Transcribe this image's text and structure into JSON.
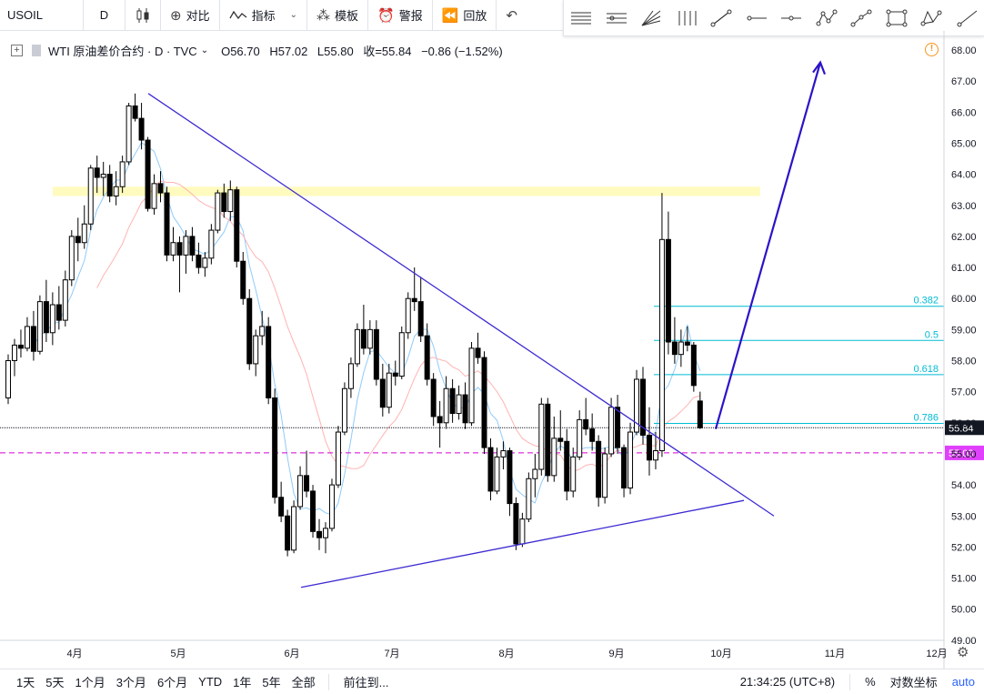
{
  "toolbar": {
    "symbol": "USOIL",
    "resolution": "D",
    "compare": "对比",
    "indicators": "指标",
    "templates": "模板",
    "alert": "警报",
    "replay": "回放"
  },
  "legend": {
    "title": "WTI 原油差价合约 · D · TVC",
    "open": "O56.70",
    "high": "H57.02",
    "low": "L55.80",
    "close": "收=55.84",
    "change": "−0.86 (−1.52%)"
  },
  "drawing_tools": [
    "horizontal-lines-icon",
    "channel-icon",
    "fan-icon",
    "pitchfork-icon",
    "trend-line-icon",
    "horizontal-ray-icon",
    "horizontal-line-icon",
    "pattern-icon",
    "polyline-icon",
    "rectangle-icon",
    "xabcd-icon",
    "ray-icon"
  ],
  "price_axis": {
    "labels": [
      "68.00",
      "67.00",
      "66.00",
      "65.00",
      "64.00",
      "63.00",
      "62.00",
      "61.00",
      "60.00",
      "59.00",
      "58.00",
      "57.00",
      "56.00",
      "55.00",
      "54.00",
      "53.00",
      "52.00",
      "51.00",
      "50.00",
      "49.00"
    ],
    "last_price": "55.84",
    "dashed_level": "55.03"
  },
  "time_axis": {
    "labels": [
      "4月",
      "5月",
      "6月",
      "7月",
      "8月",
      "9月",
      "10月",
      "11月",
      "12月"
    ]
  },
  "fib_labels": [
    "0.382",
    "0.5",
    "0.618",
    "0.786"
  ],
  "bottom": {
    "ranges": [
      "1天",
      "5天",
      "1个月",
      "3个月",
      "6个月",
      "YTD",
      "1年",
      "5年",
      "全部"
    ],
    "goto": "前往到...",
    "clock": "21:34:25 (UTC+8)",
    "percent": "%",
    "log": "对数坐标",
    "auto": "auto"
  },
  "colors": {
    "trendline": "#3d2bd1",
    "arrow": "#2b13c8",
    "resistance_zone": "#fffbbf",
    "fib": "#00bcd4",
    "dashed_level": "#d500d5",
    "last_price_bg": "#131722",
    "dashed_level_bg": "#e040fb",
    "ma_fast": "#90caf9",
    "ma_slow": "#ffb3b3"
  },
  "chart_data": {
    "type": "candlestick",
    "title": "",
    "ylim": [
      49,
      68
    ],
    "y_ticks": [
      68,
      67,
      66,
      65,
      64,
      63,
      62,
      61,
      60,
      59,
      58,
      57,
      56,
      55,
      54,
      53,
      52,
      51,
      50,
      49
    ],
    "x_ticks": [
      "4月",
      "5月",
      "6月",
      "7月",
      "8月",
      "9月",
      "10月",
      "11月",
      "12月"
    ],
    "last_price": 55.84,
    "dashed_level": 55.03,
    "resistance_zone": [
      63.3,
      63.6
    ],
    "fib_levels": [
      {
        "label": "0.382",
        "value": 59.75
      },
      {
        "label": "0.5",
        "value": 58.65
      },
      {
        "label": "0.618",
        "value": 57.55
      },
      {
        "label": "0.786",
        "value": 55.98
      }
    ],
    "candles": [
      {
        "o": 56.8,
        "h": 58.2,
        "l": 56.6,
        "c": 58.0
      },
      {
        "o": 58.0,
        "h": 58.7,
        "l": 57.5,
        "c": 58.5
      },
      {
        "o": 58.5,
        "h": 59.0,
        "l": 58.1,
        "c": 58.4
      },
      {
        "o": 58.4,
        "h": 59.4,
        "l": 58.3,
        "c": 59.1
      },
      {
        "o": 59.1,
        "h": 59.6,
        "l": 58.0,
        "c": 58.3
      },
      {
        "o": 58.3,
        "h": 60.1,
        "l": 58.2,
        "c": 59.9
      },
      {
        "o": 59.9,
        "h": 60.6,
        "l": 58.6,
        "c": 58.9
      },
      {
        "o": 58.9,
        "h": 60.2,
        "l": 58.5,
        "c": 59.8
      },
      {
        "o": 59.8,
        "h": 60.4,
        "l": 59.0,
        "c": 59.3
      },
      {
        "o": 59.3,
        "h": 60.9,
        "l": 59.1,
        "c": 60.6
      },
      {
        "o": 60.6,
        "h": 62.2,
        "l": 60.4,
        "c": 62.0
      },
      {
        "o": 62.0,
        "h": 62.6,
        "l": 61.2,
        "c": 61.8
      },
      {
        "o": 61.8,
        "h": 63.0,
        "l": 61.6,
        "c": 62.4
      },
      {
        "o": 62.4,
        "h": 64.3,
        "l": 62.2,
        "c": 64.2
      },
      {
        "o": 64.2,
        "h": 64.6,
        "l": 63.4,
        "c": 63.9
      },
      {
        "o": 63.9,
        "h": 64.4,
        "l": 63.3,
        "c": 64.0
      },
      {
        "o": 64.0,
        "h": 64.3,
        "l": 63.1,
        "c": 63.3
      },
      {
        "o": 63.3,
        "h": 64.1,
        "l": 63.0,
        "c": 63.6
      },
      {
        "o": 63.6,
        "h": 64.6,
        "l": 63.4,
        "c": 64.4
      },
      {
        "o": 64.4,
        "h": 66.3,
        "l": 64.3,
        "c": 66.2
      },
      {
        "o": 66.2,
        "h": 66.6,
        "l": 65.7,
        "c": 65.8
      },
      {
        "o": 65.8,
        "h": 66.3,
        "l": 64.8,
        "c": 65.1
      },
      {
        "o": 65.1,
        "h": 65.2,
        "l": 62.8,
        "c": 62.9
      },
      {
        "o": 62.9,
        "h": 64.0,
        "l": 62.7,
        "c": 63.7
      },
      {
        "o": 63.7,
        "h": 64.1,
        "l": 63.1,
        "c": 63.4
      },
      {
        "o": 63.4,
        "h": 63.6,
        "l": 61.2,
        "c": 61.4
      },
      {
        "o": 61.4,
        "h": 62.3,
        "l": 61.2,
        "c": 61.8
      },
      {
        "o": 61.8,
        "h": 62.0,
        "l": 60.2,
        "c": 61.4
      },
      {
        "o": 61.4,
        "h": 62.2,
        "l": 60.8,
        "c": 62.0
      },
      {
        "o": 62.0,
        "h": 62.3,
        "l": 61.2,
        "c": 61.4
      },
      {
        "o": 61.4,
        "h": 61.8,
        "l": 60.8,
        "c": 61.0
      },
      {
        "o": 61.0,
        "h": 61.5,
        "l": 60.7,
        "c": 61.3
      },
      {
        "o": 61.3,
        "h": 62.4,
        "l": 61.1,
        "c": 62.2
      },
      {
        "o": 62.2,
        "h": 63.5,
        "l": 62.1,
        "c": 63.4
      },
      {
        "o": 63.4,
        "h": 63.7,
        "l": 62.6,
        "c": 62.8
      },
      {
        "o": 62.8,
        "h": 63.8,
        "l": 62.5,
        "c": 63.5
      },
      {
        "o": 63.5,
        "h": 63.6,
        "l": 61.0,
        "c": 61.2
      },
      {
        "o": 61.2,
        "h": 61.5,
        "l": 59.8,
        "c": 60.0
      },
      {
        "o": 60.0,
        "h": 60.3,
        "l": 57.7,
        "c": 57.9
      },
      {
        "o": 57.9,
        "h": 59.0,
        "l": 57.5,
        "c": 58.8
      },
      {
        "o": 58.8,
        "h": 59.6,
        "l": 58.5,
        "c": 59.1
      },
      {
        "o": 59.1,
        "h": 59.4,
        "l": 56.6,
        "c": 56.8
      },
      {
        "o": 56.8,
        "h": 57.1,
        "l": 53.4,
        "c": 53.6
      },
      {
        "o": 53.6,
        "h": 54.1,
        "l": 52.8,
        "c": 53.0
      },
      {
        "o": 53.0,
        "h": 53.2,
        "l": 51.7,
        "c": 51.9
      },
      {
        "o": 51.9,
        "h": 53.5,
        "l": 51.8,
        "c": 53.3
      },
      {
        "o": 53.3,
        "h": 54.6,
        "l": 53.2,
        "c": 54.3
      },
      {
        "o": 54.3,
        "h": 55.1,
        "l": 53.6,
        "c": 53.8
      },
      {
        "o": 53.8,
        "h": 54.0,
        "l": 52.3,
        "c": 52.5
      },
      {
        "o": 52.5,
        "h": 52.9,
        "l": 51.9,
        "c": 52.3
      },
      {
        "o": 52.3,
        "h": 52.8,
        "l": 51.8,
        "c": 52.6
      },
      {
        "o": 52.6,
        "h": 54.2,
        "l": 52.5,
        "c": 54.0
      },
      {
        "o": 54.0,
        "h": 55.9,
        "l": 53.9,
        "c": 55.7
      },
      {
        "o": 55.7,
        "h": 57.3,
        "l": 55.6,
        "c": 57.1
      },
      {
        "o": 57.1,
        "h": 58.1,
        "l": 56.8,
        "c": 57.9
      },
      {
        "o": 57.9,
        "h": 59.2,
        "l": 57.8,
        "c": 59.0
      },
      {
        "o": 59.0,
        "h": 59.8,
        "l": 58.2,
        "c": 58.4
      },
      {
        "o": 58.4,
        "h": 59.3,
        "l": 58.2,
        "c": 59.0
      },
      {
        "o": 59.0,
        "h": 59.3,
        "l": 57.2,
        "c": 57.4
      },
      {
        "o": 57.4,
        "h": 57.9,
        "l": 56.2,
        "c": 56.5
      },
      {
        "o": 56.5,
        "h": 57.9,
        "l": 56.3,
        "c": 57.6
      },
      {
        "o": 57.6,
        "h": 58.0,
        "l": 57.2,
        "c": 57.5
      },
      {
        "o": 57.5,
        "h": 59.1,
        "l": 57.4,
        "c": 58.9
      },
      {
        "o": 58.9,
        "h": 60.2,
        "l": 58.7,
        "c": 60.0
      },
      {
        "o": 60.0,
        "h": 61.0,
        "l": 59.6,
        "c": 59.9
      },
      {
        "o": 59.9,
        "h": 60.7,
        "l": 58.6,
        "c": 58.8
      },
      {
        "o": 58.8,
        "h": 59.2,
        "l": 57.2,
        "c": 57.4
      },
      {
        "o": 57.4,
        "h": 57.6,
        "l": 55.9,
        "c": 56.2
      },
      {
        "o": 56.2,
        "h": 56.7,
        "l": 55.2,
        "c": 56.0
      },
      {
        "o": 56.0,
        "h": 57.5,
        "l": 55.8,
        "c": 57.1
      },
      {
        "o": 57.1,
        "h": 57.4,
        "l": 56.0,
        "c": 56.3
      },
      {
        "o": 56.3,
        "h": 57.2,
        "l": 56.1,
        "c": 56.9
      },
      {
        "o": 56.9,
        "h": 57.3,
        "l": 55.8,
        "c": 56.0
      },
      {
        "o": 56.0,
        "h": 58.6,
        "l": 55.9,
        "c": 58.4
      },
      {
        "o": 58.4,
        "h": 58.9,
        "l": 57.9,
        "c": 58.1
      },
      {
        "o": 58.1,
        "h": 58.3,
        "l": 55.0,
        "c": 55.2
      },
      {
        "o": 55.2,
        "h": 55.5,
        "l": 53.5,
        "c": 53.8
      },
      {
        "o": 53.8,
        "h": 55.2,
        "l": 53.7,
        "c": 54.9
      },
      {
        "o": 54.9,
        "h": 55.4,
        "l": 54.5,
        "c": 55.1
      },
      {
        "o": 55.1,
        "h": 55.2,
        "l": 53.0,
        "c": 53.4
      },
      {
        "o": 53.4,
        "h": 53.6,
        "l": 51.9,
        "c": 52.1
      },
      {
        "o": 52.1,
        "h": 53.1,
        "l": 52.0,
        "c": 52.9
      },
      {
        "o": 52.9,
        "h": 54.4,
        "l": 52.8,
        "c": 54.2
      },
      {
        "o": 54.2,
        "h": 55.0,
        "l": 53.6,
        "c": 54.5
      },
      {
        "o": 54.5,
        "h": 56.8,
        "l": 54.3,
        "c": 56.6
      },
      {
        "o": 56.6,
        "h": 56.8,
        "l": 54.1,
        "c": 54.3
      },
      {
        "o": 54.3,
        "h": 56.2,
        "l": 54.1,
        "c": 55.5
      },
      {
        "o": 55.5,
        "h": 56.4,
        "l": 55.1,
        "c": 55.4
      },
      {
        "o": 55.4,
        "h": 55.8,
        "l": 53.5,
        "c": 53.8
      },
      {
        "o": 53.8,
        "h": 55.2,
        "l": 53.6,
        "c": 54.9
      },
      {
        "o": 54.9,
        "h": 56.4,
        "l": 54.8,
        "c": 56.1
      },
      {
        "o": 56.1,
        "h": 56.8,
        "l": 55.6,
        "c": 55.8
      },
      {
        "o": 55.8,
        "h": 56.3,
        "l": 55.1,
        "c": 55.4
      },
      {
        "o": 55.4,
        "h": 55.6,
        "l": 53.3,
        "c": 53.6
      },
      {
        "o": 53.6,
        "h": 55.2,
        "l": 53.4,
        "c": 55.0
      },
      {
        "o": 55.0,
        "h": 56.8,
        "l": 54.9,
        "c": 56.5
      },
      {
        "o": 56.5,
        "h": 56.9,
        "l": 55.0,
        "c": 55.2
      },
      {
        "o": 55.2,
        "h": 55.3,
        "l": 53.6,
        "c": 53.9
      },
      {
        "o": 53.9,
        "h": 56.0,
        "l": 53.7,
        "c": 55.7
      },
      {
        "o": 55.7,
        "h": 57.7,
        "l": 55.6,
        "c": 57.4
      },
      {
        "o": 57.4,
        "h": 57.8,
        "l": 55.3,
        "c": 55.6
      },
      {
        "o": 55.6,
        "h": 56.5,
        "l": 54.3,
        "c": 54.8
      },
      {
        "o": 54.8,
        "h": 55.7,
        "l": 54.5,
        "c": 55.1
      },
      {
        "o": 55.1,
        "h": 63.4,
        "l": 54.9,
        "c": 61.9
      },
      {
        "o": 61.9,
        "h": 62.8,
        "l": 58.2,
        "c": 58.6
      },
      {
        "o": 58.6,
        "h": 59.4,
        "l": 57.9,
        "c": 58.2
      },
      {
        "o": 58.2,
        "h": 59.0,
        "l": 57.8,
        "c": 58.6
      },
      {
        "o": 58.6,
        "h": 59.1,
        "l": 58.3,
        "c": 58.5
      },
      {
        "o": 58.5,
        "h": 58.6,
        "l": 57.0,
        "c": 57.2
      },
      {
        "o": 56.7,
        "h": 57.0,
        "l": 55.8,
        "c": 55.84
      }
    ],
    "trendlines": [
      {
        "name": "upper-descending",
        "points": [
          [
            "4月下旬",
            66.6
          ],
          [
            "10月中旬",
            53.0
          ]
        ]
      },
      {
        "name": "lower-ascending",
        "points": [
          [
            "6月初",
            50.7
          ],
          [
            "10月中旬",
            53.5
          ]
        ]
      }
    ],
    "projection_arrow": [
      55.8,
      67.6
    ]
  }
}
